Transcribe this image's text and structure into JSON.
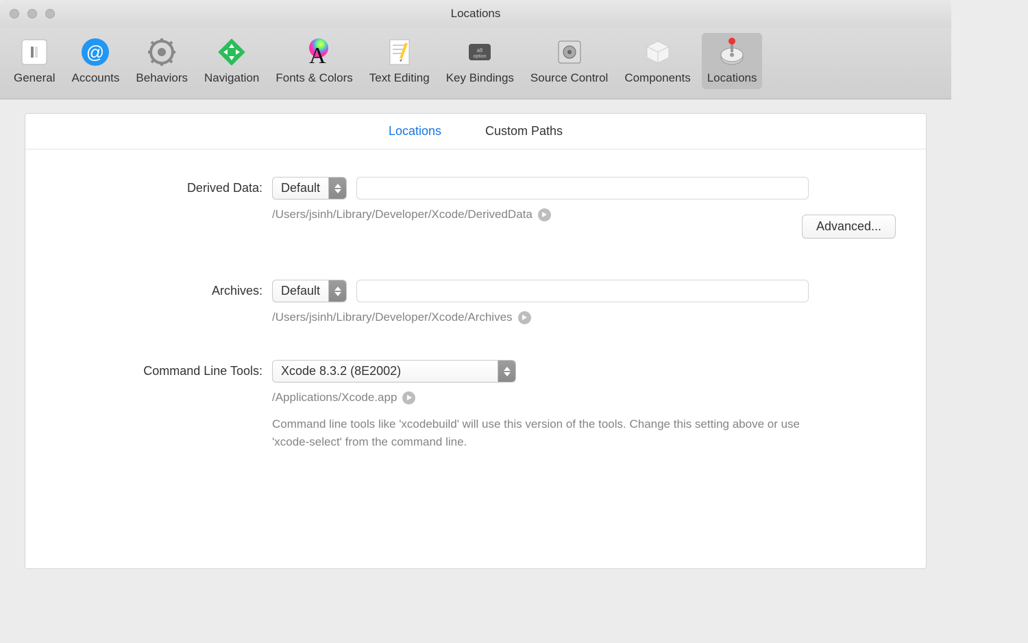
{
  "window": {
    "title": "Locations"
  },
  "toolbar": {
    "items": [
      {
        "label": "General"
      },
      {
        "label": "Accounts"
      },
      {
        "label": "Behaviors"
      },
      {
        "label": "Navigation"
      },
      {
        "label": "Fonts & Colors"
      },
      {
        "label": "Text Editing"
      },
      {
        "label": "Key Bindings"
      },
      {
        "label": "Source Control"
      },
      {
        "label": "Components"
      },
      {
        "label": "Locations"
      }
    ]
  },
  "tabs": {
    "locations": "Locations",
    "custom_paths": "Custom Paths"
  },
  "derived_data": {
    "label": "Derived Data:",
    "value": "Default",
    "path": "/Users/jsinh/Library/Developer/Xcode/DerivedData",
    "advanced_label": "Advanced..."
  },
  "archives": {
    "label": "Archives:",
    "value": "Default",
    "path": "/Users/jsinh/Library/Developer/Xcode/Archives"
  },
  "cli_tools": {
    "label": "Command Line Tools:",
    "value": "Xcode 8.3.2 (8E2002)",
    "path": "/Applications/Xcode.app",
    "description": "Command line tools like 'xcodebuild' will use this version of the tools. Change this setting above or use 'xcode-select' from the command line."
  }
}
